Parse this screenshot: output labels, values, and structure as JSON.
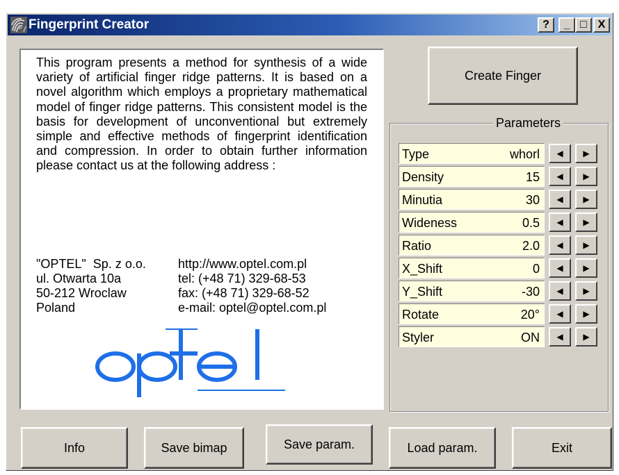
{
  "window": {
    "title": "Fingerprint Creator",
    "help_label": "?",
    "minimize_label": "_",
    "maximize_label": "□",
    "close_label": "X"
  },
  "description": "This program presents a method for synthesis of a wide variety of artificial finger ridge patterns. It is based on a novel algorithm which employs a proprietary mathematical model of finger ridge patterns. This consistent model is the basis for development of unconventional but extremely simple and effective methods of fingerprint identification and compression. In order to obtain further information please contact us at the following address :",
  "address": {
    "left": [
      "\"OPTEL\"  Sp. z o.o.",
      "ul. Otwarta 10a",
      "50-212 Wroclaw",
      "Poland"
    ],
    "right": [
      "http://www.optel.com.pl",
      "tel: (+48 71) 329-68-53",
      "fax: (+48 71) 329-68-52",
      "e-mail: optel@optel.com.pl"
    ]
  },
  "logo_text": "optel",
  "create_button": "Create Finger",
  "parameters": {
    "title": "Parameters",
    "rows": [
      {
        "name": "Type",
        "value": "whorl"
      },
      {
        "name": "Density",
        "value": "15"
      },
      {
        "name": "Minutia",
        "value": "30"
      },
      {
        "name": "Wideness",
        "value": "0.5"
      },
      {
        "name": "Ratio",
        "value": "2.0"
      },
      {
        "name": "X_Shift",
        "value": "0"
      },
      {
        "name": "Y_Shift",
        "value": "-30"
      },
      {
        "name": "Rotate",
        "value": "20°"
      },
      {
        "name": "Styler",
        "value": "ON"
      }
    ],
    "left_arrow": "◀",
    "right_arrow": "▶"
  },
  "buttons": {
    "info": "Info",
    "save_bitmap": "Save bimap",
    "save_param": "Save param.",
    "load_param": "Load param.",
    "exit": "Exit"
  },
  "colors": {
    "titlebar_start": "#0a246a",
    "titlebar_end": "#a6caf0",
    "face": "#d4d0c8",
    "param_field": "#ffffe0",
    "logo_blue": "#1e6fe8"
  }
}
